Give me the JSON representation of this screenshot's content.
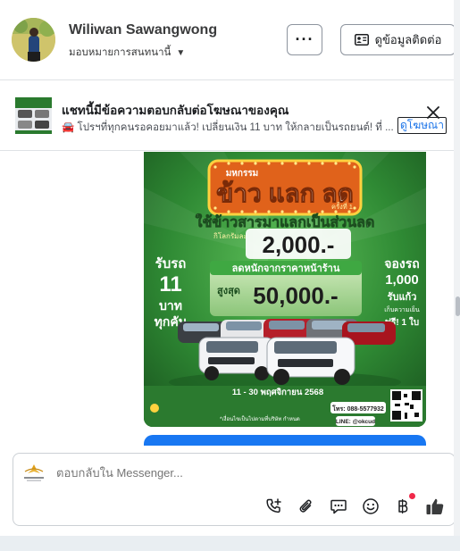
{
  "header": {
    "user_name": "Wiliwan Sawangwong",
    "assign_label": "มอบหมายการสนทนานี้",
    "more_label": "···",
    "contact_label": "ดูข้อมูลติดต่อ"
  },
  "banner": {
    "title": "แชทนี้มีข้อความตอบกลับต่อโฆษณาของคุณ",
    "subtitle": "🚘 โปรฯที่ทุกคนรอคอยมาแล้ว! เปลี่ยนเงิน 11 บาท ให้กลายเป็นรถยนต์! ที่ ...",
    "link_label": "ดูโฆษณา"
  },
  "ad": {
    "festival_label": "มหกรรม",
    "headline": "ข้าว แลก ลด",
    "round_label": "ครั้งที่ 1",
    "subhead": "ใช้ข้าวสารมาแลกเป็นส่วนลด",
    "per_kg_label": "กิโลกรัมละ",
    "per_kg_price": "2,000.-",
    "discount_label": "ลดหนักจากราคาหน้าร้าน",
    "max_label": "สูงสุด",
    "max_value": "50,000.-",
    "left_text": [
      "รับรถ",
      "11",
      "บาท",
      "ทุกคัน"
    ],
    "right_text": [
      "จองรถ",
      "1,000",
      "รับแก้ว",
      "เก็บความเย็น",
      "ฟรี! 1 ใบ"
    ],
    "date_text": "11 - 30 พฤศจิกายน 2568",
    "phone_text": "โทร: 088-5577932",
    "line_text": "LINE: @okcud",
    "footnote": "*เงื่อนไขเป็นไปตามที่บริษัท กำหนด"
  },
  "composer": {
    "placeholder": "ตอบกลับใน Messenger..."
  },
  "icons": {
    "more": "more-dots-icon",
    "contact": "contact-card-icon",
    "close": "close-icon",
    "call": "phone-add-icon",
    "attach": "paperclip-icon",
    "reply": "chat-bubble-icon",
    "emoji": "smiley-icon",
    "currency": "baht-icon",
    "like": "thumbs-up-icon"
  },
  "colors": {
    "link": "#1a73e8",
    "notification": "#f02849",
    "like": "#3a3b3c",
    "ad_green": "#2f8a34",
    "ad_orange": "#e0621b",
    "ad_yellow": "#ffd23f"
  }
}
